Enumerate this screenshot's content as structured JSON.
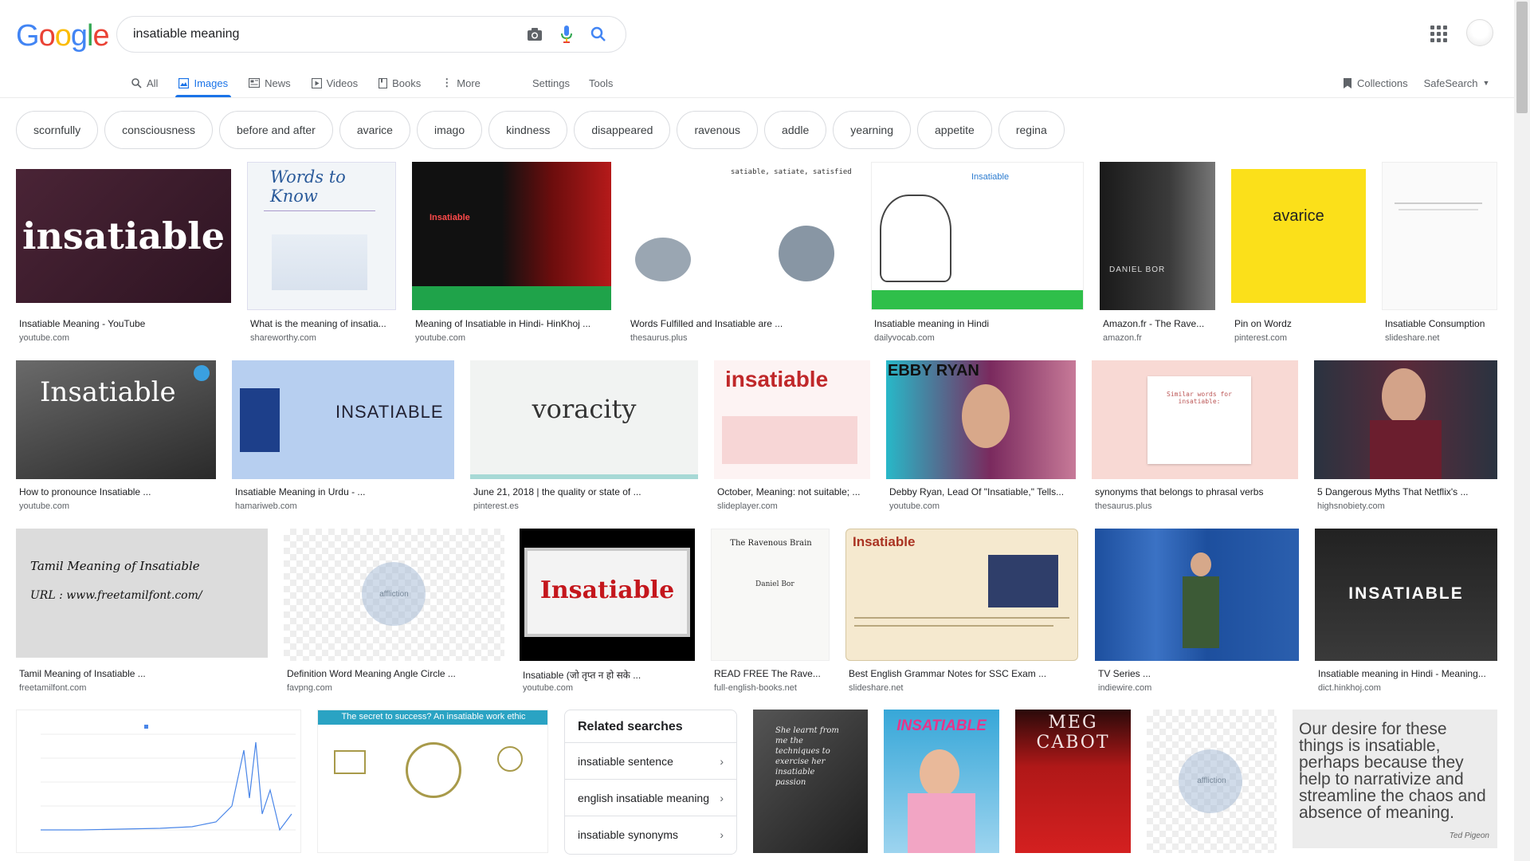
{
  "logo": "Google",
  "search": {
    "query": "insatiable meaning"
  },
  "tabs": [
    {
      "label": "All",
      "icon": "search-icon"
    },
    {
      "label": "Images",
      "icon": "image-icon"
    },
    {
      "label": "News",
      "icon": "news-icon"
    },
    {
      "label": "Videos",
      "icon": "video-icon"
    },
    {
      "label": "Books",
      "icon": "book-icon"
    },
    {
      "label": "More",
      "icon": "more-icon"
    }
  ],
  "tools": {
    "settings": "Settings",
    "tools": "Tools"
  },
  "right": {
    "collections": "Collections",
    "safesearch": "SafeSearch"
  },
  "chips": [
    "scornfully",
    "consciousness",
    "before and after",
    "avarice",
    "imago",
    "kindness",
    "disappeared",
    "ravenous",
    "addle",
    "yearning",
    "appetite",
    "regina"
  ],
  "results": [
    {
      "caption": "Insatiable Meaning - YouTube",
      "source": "youtube.com",
      "text": "insatiable"
    },
    {
      "caption": "What is the meaning of insatia...",
      "source": "shareworthy.com",
      "text": "Words to Know"
    },
    {
      "caption": "Meaning of Insatiable in Hindi- HinKhoj ...",
      "source": "youtube.com",
      "text": "Insatiable"
    },
    {
      "caption": "Words Fulfilled and Insatiable are ...",
      "source": "thesaurus.plus",
      "text": "satiable, satiate, satisfied"
    },
    {
      "caption": "Insatiable meaning in Hindi",
      "source": "dailyvocab.com",
      "text": "Insatiable"
    },
    {
      "caption": "Amazon.fr - The Rave...",
      "source": "amazon.fr",
      "text": "DANIEL BOR"
    },
    {
      "caption": "Pin on Wordz",
      "source": "pinterest.com",
      "text": "avarice"
    },
    {
      "caption": "Insatiable Consumption",
      "source": "slideshare.net",
      "text": ""
    },
    {
      "caption": "How to pronounce Insatiable ...",
      "source": "youtube.com",
      "text": "Insatiable"
    },
    {
      "caption": "Insatiable Meaning in Urdu - ...",
      "source": "hamariweb.com",
      "text": "INSATIABLE"
    },
    {
      "caption": "June 21, 2018 | the quality or state of ...",
      "source": "pinterest.es",
      "text": "voracity"
    },
    {
      "caption": "October, Meaning: not suitable; ...",
      "source": "slideplayer.com",
      "text": "insatiable"
    },
    {
      "caption": "Debby Ryan, Lead Of \"Insatiable,\" Tells...",
      "source": "youtube.com",
      "text": "EBBY RYAN"
    },
    {
      "caption": "synonyms that belongs to phrasal verbs",
      "source": "thesaurus.plus",
      "text": "Similar words for insatiable:"
    },
    {
      "caption": "5 Dangerous Myths That Netflix's ...",
      "source": "highsnobiety.com",
      "text": ""
    },
    {
      "caption": "Tamil Meaning of Insatiable ...",
      "source": "freetamilfont.com",
      "text": "Tamil Meaning of Insatiable"
    },
    {
      "caption": "Definition Word Meaning Angle Circle ...",
      "source": "favpng.com",
      "text": "affliction"
    },
    {
      "caption": "Insatiable (जो तृप्त न हो सके ...",
      "source": "youtube.com",
      "text": "Insatiable"
    },
    {
      "caption": "READ FREE The Rave...",
      "source": "full-english-books.net",
      "text": "The Ravenous Brain"
    },
    {
      "caption": "Best English Grammar Notes for SSC Exam ...",
      "source": "slideshare.net",
      "text": "Insatiable"
    },
    {
      "caption": "TV Series ...",
      "source": "indiewire.com",
      "text": ""
    },
    {
      "caption": "Insatiable meaning in Hindi - Meaning...",
      "source": "dict.hinkhoj.com",
      "text": "INSATIABLE"
    }
  ],
  "bottom_row": [
    {
      "text": ""
    },
    {
      "text": "The secret to success? An insatiable work ethic"
    },
    {
      "text": ""
    },
    {
      "text": "INSATIABLE"
    },
    {
      "text": "MEG CABOT"
    },
    {
      "text": "affliction"
    },
    {
      "text": "Our desire for these things is insatiable, perhaps because they help to narrativize and streamline the chaos and absence of meaning."
    }
  ],
  "related": {
    "title": "Related searches",
    "items": [
      "insatiable sentence",
      "english insatiable meaning",
      "insatiable synonyms"
    ]
  }
}
